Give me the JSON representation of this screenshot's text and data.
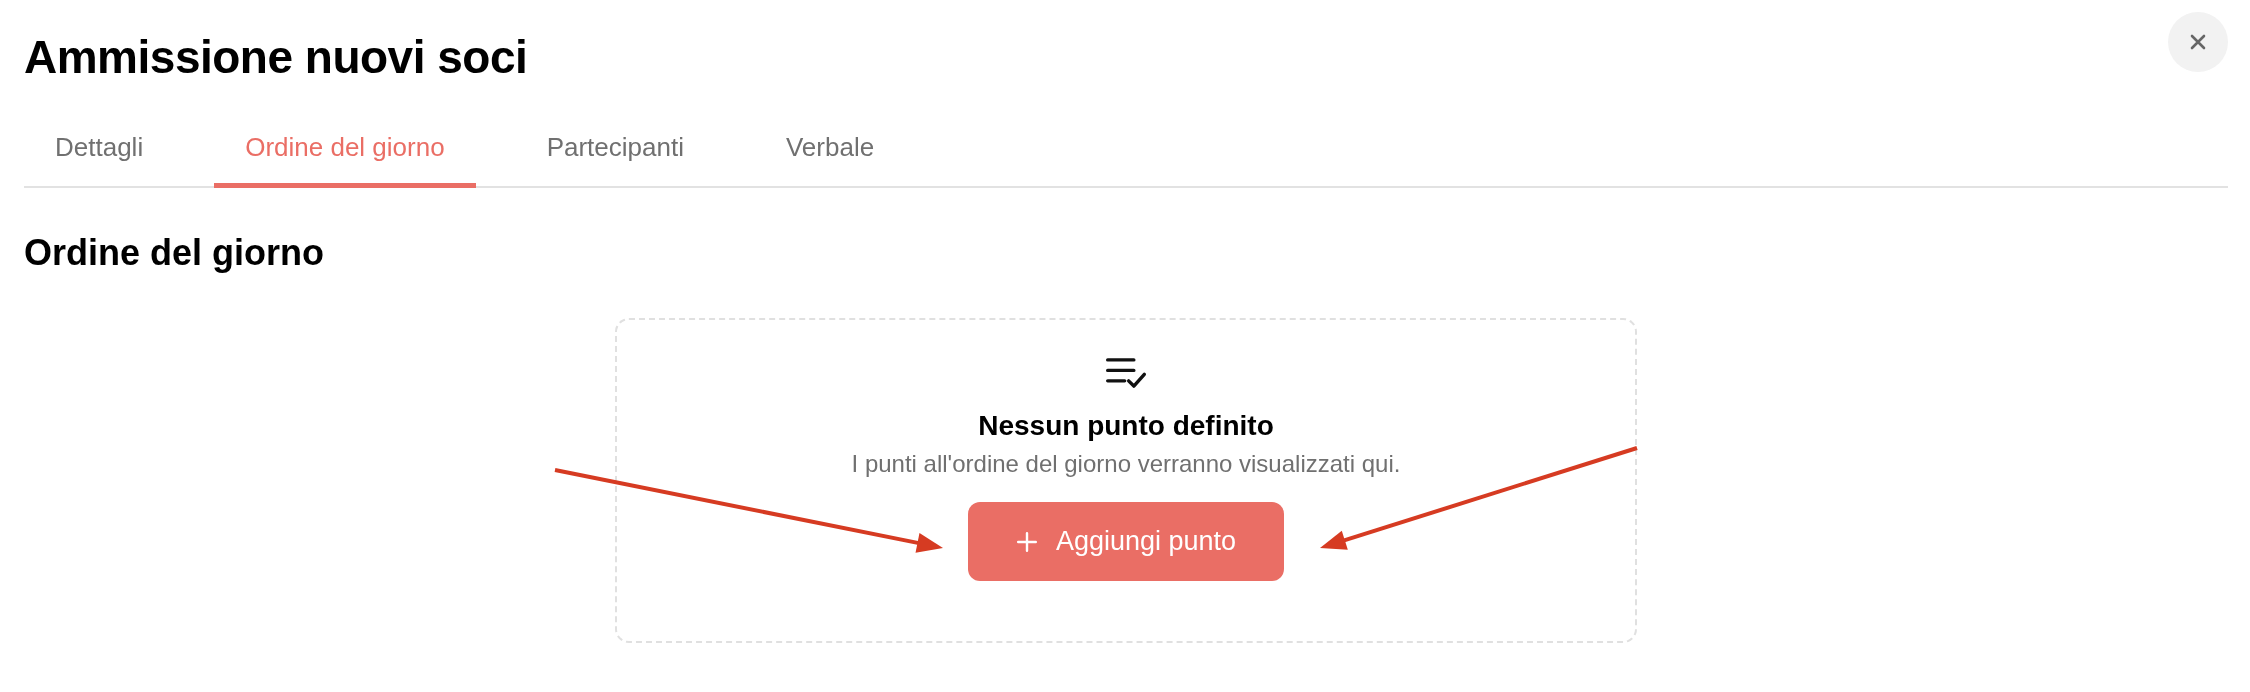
{
  "dialog": {
    "title": "Ammissione nuovi soci"
  },
  "tabs": [
    {
      "label": "Dettagli",
      "selected": false
    },
    {
      "label": "Ordine del giorno",
      "selected": true
    },
    {
      "label": "Partecipanti",
      "selected": false
    },
    {
      "label": "Verbale",
      "selected": false
    }
  ],
  "section": {
    "heading": "Ordine del giorno"
  },
  "empty_state": {
    "title": "Nessun punto definito",
    "description": "I punti all'ordine del giorno verranno visualizzati qui.",
    "button": "Aggiungi punto"
  },
  "annotations": [
    {
      "kind": "arrow"
    },
    {
      "kind": "arrow"
    }
  ]
}
